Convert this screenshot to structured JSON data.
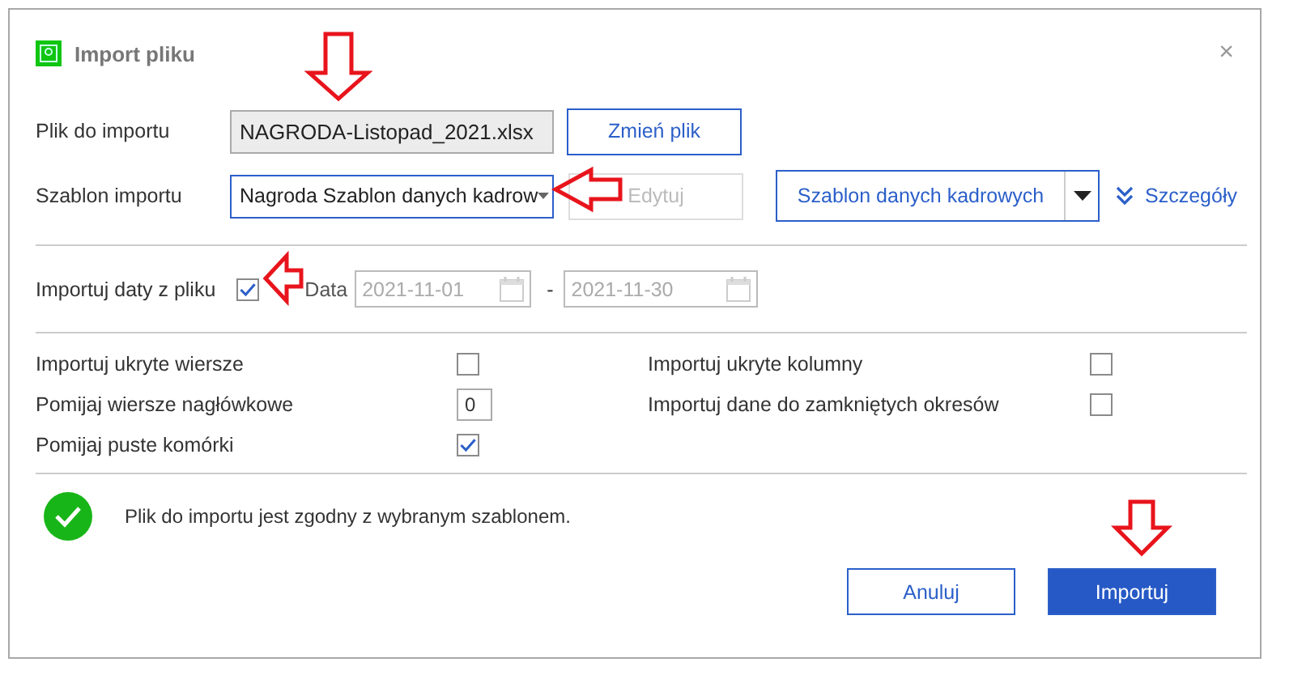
{
  "window": {
    "title": "Import pliku",
    "close": "×"
  },
  "file": {
    "label": "Plik do importu",
    "value": "NAGRODA-Listopad_2021.xlsx",
    "button": "Zmień plik"
  },
  "template": {
    "label": "Szablon importu",
    "value": "Nagroda Szablon danych kadrow",
    "edit_button": "Edytuj",
    "edit_disabled": true,
    "split_button": "Szablon danych kadrowych",
    "details_link": "Szczegóły"
  },
  "dates": {
    "label": "Importuj daty z pliku",
    "checked": true,
    "date_label": "Data",
    "from": "2021-11-01",
    "separator": "-",
    "to": "2021-11-30",
    "disabled": true
  },
  "options": [
    {
      "label": "Importuj ukryte wiersze",
      "kind": "checkbox",
      "checked": false
    },
    {
      "label": "Importuj ukryte kolumny",
      "kind": "checkbox",
      "checked": false
    },
    {
      "label": "Pomijaj wiersze nagłówkowe",
      "kind": "number",
      "value": "0"
    },
    {
      "label": "Importuj dane do zamkniętych okresów",
      "kind": "checkbox",
      "checked": false
    },
    {
      "label": "Pomijaj puste komórki",
      "kind": "checkbox",
      "checked": true
    }
  ],
  "status": {
    "kind": "success",
    "message": "Plik do importu jest zgodny z wybranym szablonem."
  },
  "buttons": [
    {
      "label": "Anuluj",
      "kind": "secondary"
    },
    {
      "label": "Importuj",
      "kind": "primary"
    }
  ]
}
